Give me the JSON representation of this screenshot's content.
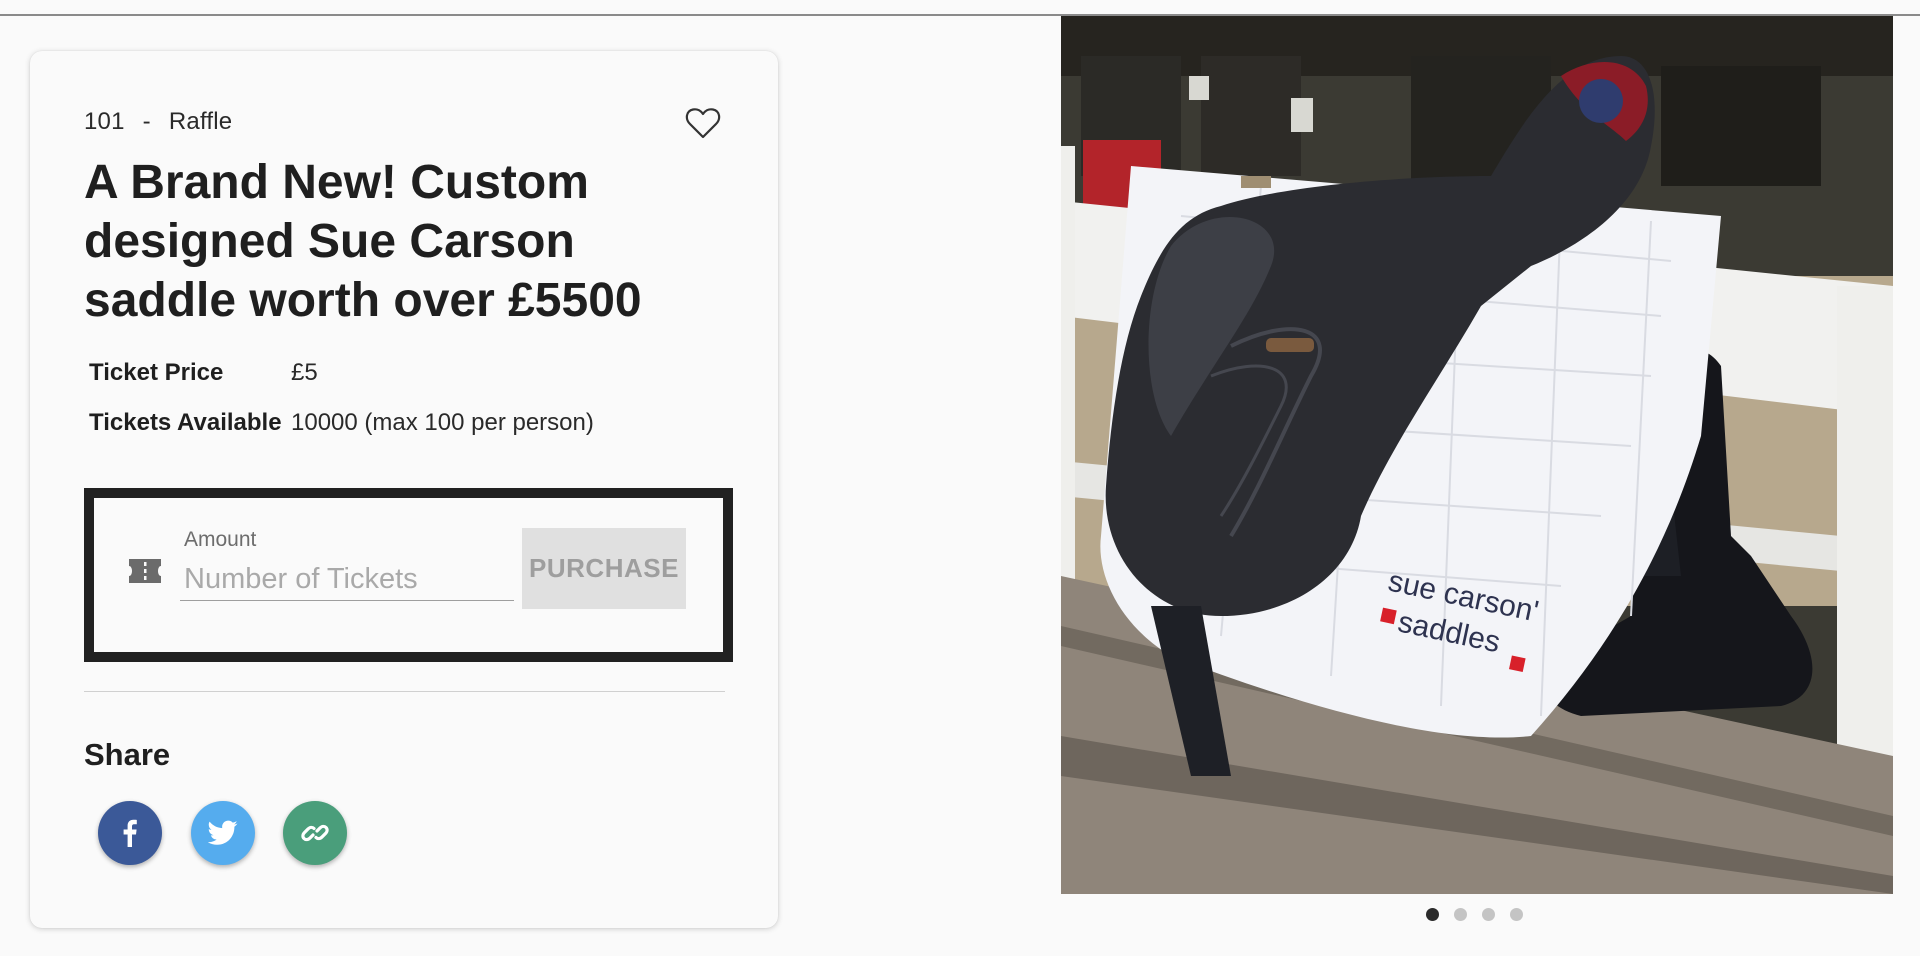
{
  "listing": {
    "number": "101",
    "separator": "-",
    "type": "Raffle",
    "title": "A Brand New! Custom designed Sue Carson saddle worth over £5500"
  },
  "details": {
    "ticket_price_label": "Ticket Price",
    "ticket_price_value": "£5",
    "tickets_available_label": "Tickets Available",
    "tickets_available_value": "10000 (max 100 per person)"
  },
  "purchase": {
    "amount_label": "Amount",
    "amount_value": "",
    "amount_placeholder": "Number of Tickets",
    "button_label": "PURCHASE"
  },
  "share": {
    "title": "Share",
    "buttons": [
      {
        "icon": "facebook-icon",
        "color": "#3b5998"
      },
      {
        "icon": "twitter-icon",
        "color": "#55acee"
      },
      {
        "icon": "link-icon",
        "color": "#4a9e7b"
      }
    ]
  },
  "gallery": {
    "image_text": [
      "sue carson'",
      "saddles"
    ],
    "image_count": 4,
    "active_index": 0
  },
  "colors": {
    "title": "#1f1f1f",
    "purchase_disabled_bg": "#e0e0e0",
    "purchase_disabled_text": "#9e9e9e",
    "box_border": "#212121"
  }
}
